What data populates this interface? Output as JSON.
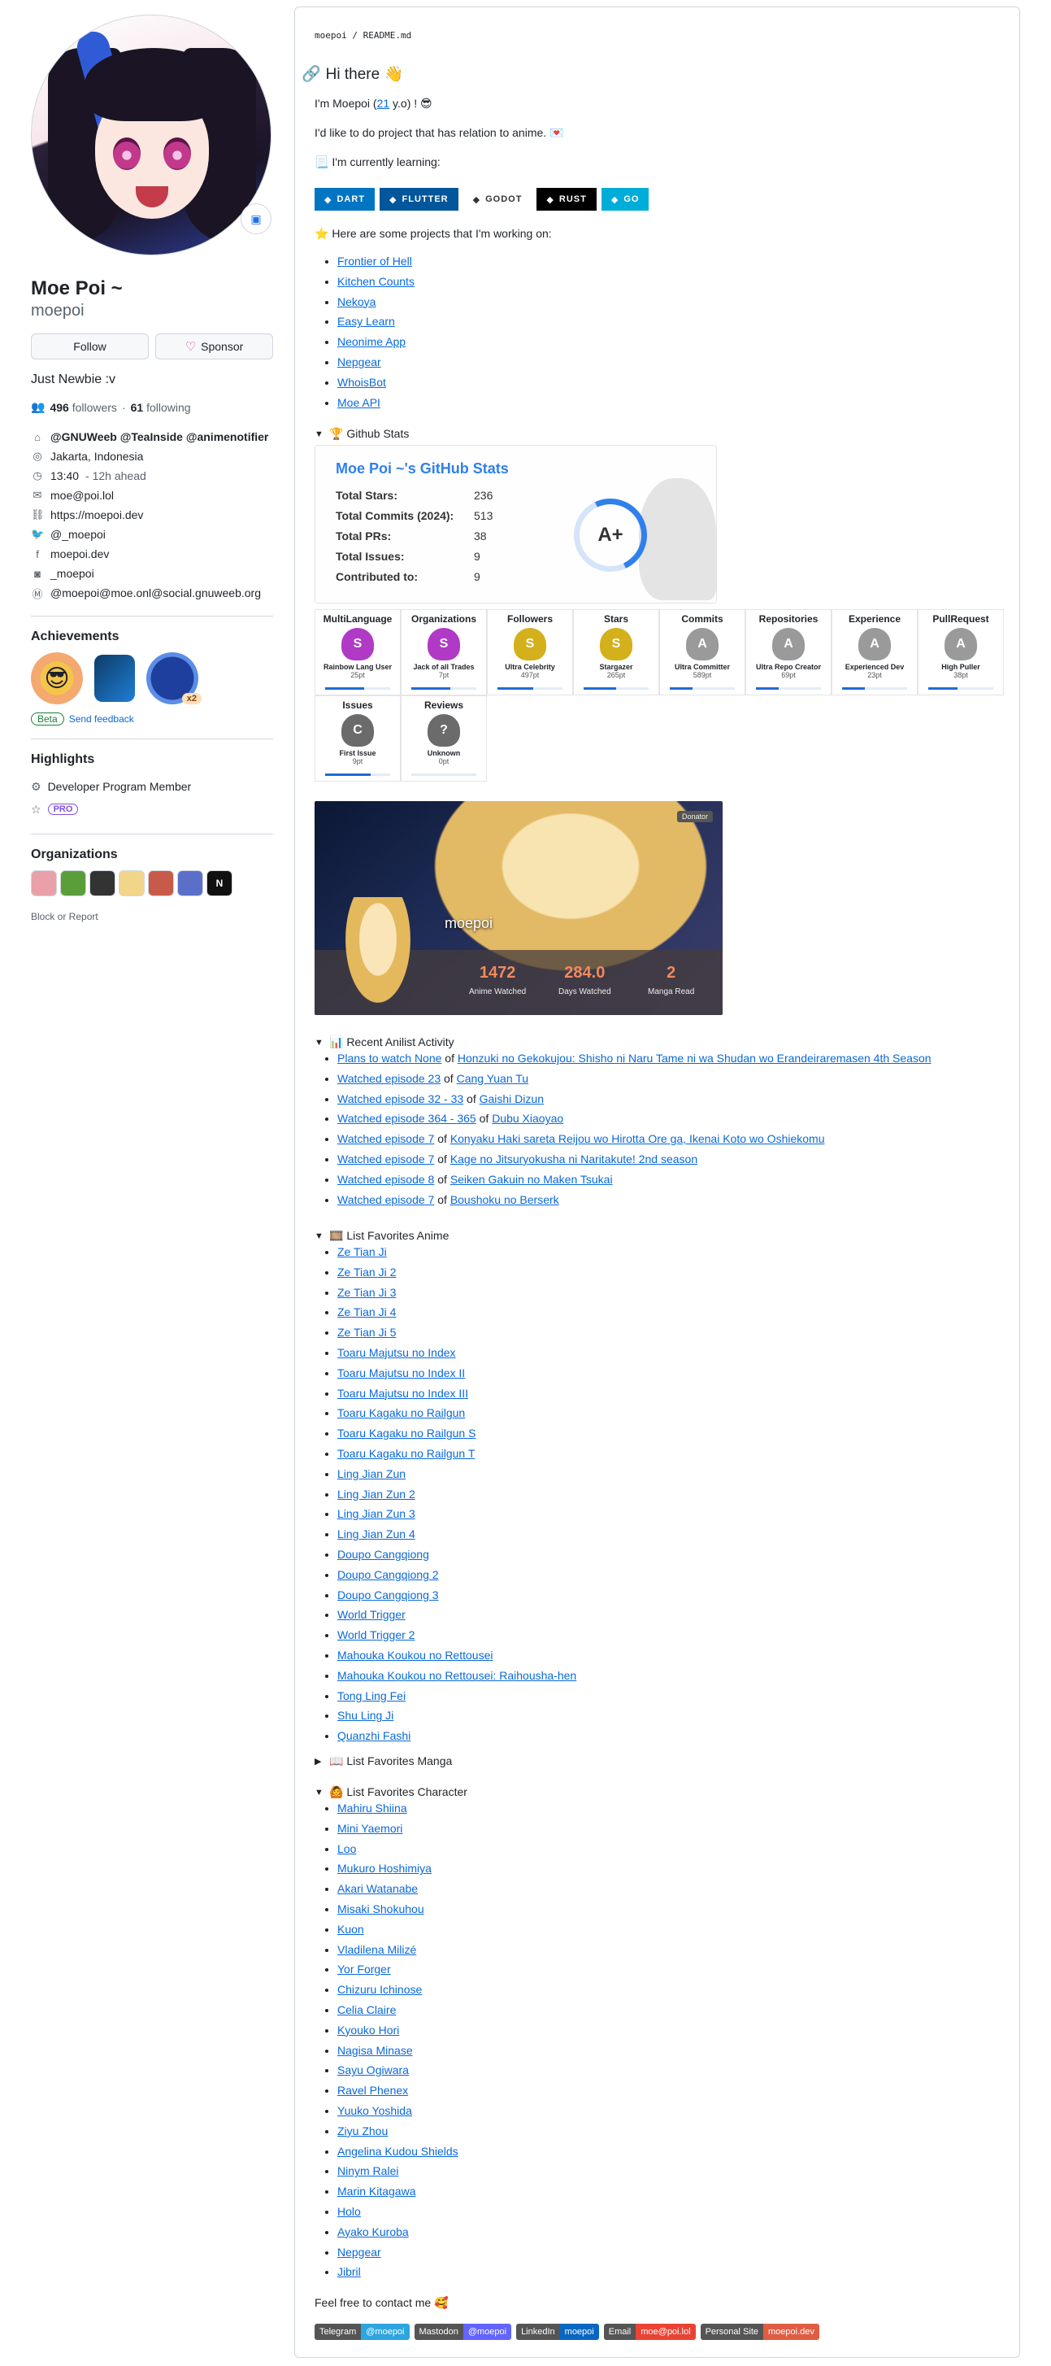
{
  "profile": {
    "fullname": "Moe Poi ~",
    "login": "moepoi",
    "follow_label": "Follow",
    "sponsor_label": "Sponsor",
    "bio": "Just Newbie :v",
    "followers": "496",
    "followers_label": "followers",
    "dot": "·",
    "following": "61",
    "following_label": "following",
    "details": [
      {
        "icon": "organization-icon",
        "glyph": "⌂",
        "text": "@GNUWeeb @TeaInside @animenotifier",
        "bold": true
      },
      {
        "icon": "location-icon",
        "glyph": "◎",
        "text": "Jakarta, Indonesia"
      },
      {
        "icon": "clock-icon",
        "glyph": "◷",
        "text": "13:40",
        "suffix": " - 12h ahead"
      },
      {
        "icon": "mail-icon",
        "glyph": "✉",
        "text": "moe@poi.lol"
      },
      {
        "icon": "link-icon",
        "glyph": "⛓",
        "text": "https://moepoi.dev"
      },
      {
        "icon": "twitter-icon",
        "glyph": "🐦",
        "text": "@_moepoi"
      },
      {
        "icon": "facebook-icon",
        "glyph": "f",
        "text": "moepoi.dev"
      },
      {
        "icon": "instagram-icon",
        "glyph": "◙",
        "text": "_moepoi"
      },
      {
        "icon": "mastodon-icon",
        "glyph": "Ⓜ",
        "text": "@moepoi@moe.onl@social.gnuweeb.org"
      }
    ],
    "achievements_title": "Achievements",
    "achievement_badge": "x2",
    "beta_label": "Beta",
    "feedback_label": "Send feedback",
    "highlights_title": "Highlights",
    "highlight_member": "Developer Program Member",
    "highlight_pro": "PRO",
    "organizations_title": "Organizations",
    "block_label": "Block or Report"
  },
  "readme": {
    "path_user": "moepoi",
    "path_sep": " / ",
    "path_file": "README.md",
    "greeting": "Hi there 👋",
    "intro_pre": "I'm Moepoi (",
    "intro_age": "21",
    "intro_post": " y.o) ! 😎",
    "intro_anime": "I'd like to do project that has relation to anime. 💌",
    "learning": "📃 I'm currently learning:",
    "langs": [
      {
        "label": "DART",
        "color": "#0175c2"
      },
      {
        "label": "FLUTTER",
        "color": "#02569b"
      },
      {
        "label": "GODOT",
        "color": "#ffffff"
      },
      {
        "label": "RUST",
        "color": "#000000"
      },
      {
        "label": "GO",
        "color": "#00add8"
      }
    ],
    "projects_intro": "⭐ Here are some projects that I'm working on:",
    "projects": [
      "Frontier of Hell",
      "Kitchen Counts",
      "Nekoya",
      "Easy Learn",
      "Neonime App",
      "Nepgear",
      "WhoisBot",
      "Moe API"
    ],
    "github_stats_summary": "🏆 Github Stats",
    "stats": {
      "title": "Moe Poi ~'s GitHub Stats",
      "rows": [
        {
          "k": "Total Stars:",
          "v": "236"
        },
        {
          "k": "Total Commits (2024):",
          "v": "513"
        },
        {
          "k": "Total PRs:",
          "v": "38"
        },
        {
          "k": "Total Issues:",
          "v": "9"
        },
        {
          "k": "Contributed to:",
          "v": "9"
        }
      ],
      "grade": "A+",
      "grade_fraction": 0.35
    },
    "trophies": [
      {
        "t": "MultiLanguage",
        "rank": "S",
        "n": "Rainbow Lang User",
        "pt": "25pt",
        "color": "#b03ac6",
        "progress": 0.6
      },
      {
        "t": "Organizations",
        "rank": "S",
        "n": "Jack of all Trades",
        "pt": "7pt",
        "color": "#b03ac6",
        "progress": 0.6
      },
      {
        "t": "Followers",
        "rank": "S",
        "n": "Ultra Celebrity",
        "pt": "497pt",
        "color": "#d4b01c",
        "progress": 0.55
      },
      {
        "t": "Stars",
        "rank": "S",
        "n": "Stargazer",
        "pt": "265pt",
        "color": "#d4b01c",
        "progress": 0.5
      },
      {
        "t": "Commits",
        "rank": "A",
        "n": "Ultra Committer",
        "pt": "589pt",
        "color": "#9a9a9a",
        "progress": 0.35
      },
      {
        "t": "Repositories",
        "rank": "A",
        "n": "Ultra Repo Creator",
        "pt": "69pt",
        "color": "#9a9a9a",
        "progress": 0.35
      },
      {
        "t": "Experience",
        "rank": "A",
        "n": "Experienced Dev",
        "pt": "23pt",
        "color": "#9a9a9a",
        "progress": 0.35
      },
      {
        "t": "PullRequest",
        "rank": "A",
        "n": "High Puller",
        "pt": "38pt",
        "color": "#9a9a9a",
        "progress": 0.45
      },
      {
        "t": "Issues",
        "rank": "C",
        "n": "First Issue",
        "pt": "9pt",
        "color": "#6b6b6b",
        "progress": 0.7
      },
      {
        "t": "Reviews",
        "rank": "?",
        "n": "Unknown",
        "pt": "0pt",
        "color": "#6b6b6b",
        "progress": 0.0
      }
    ],
    "anilist": {
      "name": "moepoi",
      "donator": "Donator",
      "stats": [
        {
          "num": "1472",
          "lbl": "Anime Watched"
        },
        {
          "num": "284.0",
          "lbl": "Days Watched"
        },
        {
          "num": "2",
          "lbl": "Manga Read"
        }
      ]
    },
    "activity_summary": "📊 Recent Anilist Activity",
    "activity": [
      {
        "a": "Plans to watch None",
        "b": "Honzuki no Gekokujou: Shisho ni Naru Tame ni wa Shudan wo Erandeiraremasen 4th Season"
      },
      {
        "a": "Watched episode 23",
        "b": "Cang Yuan Tu"
      },
      {
        "a": "Watched episode 32 - 33",
        "b": "Gaishi Dizun"
      },
      {
        "a": "Watched episode 364 - 365",
        "b": "Dubu Xiaoyao"
      },
      {
        "a": "Watched episode 7",
        "b": "Konyaku Haki sareta Reijou wo Hirotta Ore ga, Ikenai Koto wo Oshiekomu"
      },
      {
        "a": "Watched episode 7",
        "b": "Kage no Jitsuryokusha ni Naritakute! 2nd season"
      },
      {
        "a": "Watched episode 8",
        "b": "Seiken Gakuin no Maken Tsukai"
      },
      {
        "a": "Watched episode 7",
        "b": "Boushoku no Berserk"
      }
    ],
    "of_label": " of ",
    "fav_anime_summary": "🎞️ List Favorites Anime",
    "fav_anime": [
      "Ze Tian Ji",
      "Ze Tian Ji 2",
      "Ze Tian Ji 3",
      "Ze Tian Ji 4",
      "Ze Tian Ji 5",
      "Toaru Majutsu no Index",
      "Toaru Majutsu no Index II",
      "Toaru Majutsu no Index III",
      "Toaru Kagaku no Railgun",
      "Toaru Kagaku no Railgun S",
      "Toaru Kagaku no Railgun T",
      "Ling Jian Zun",
      "Ling Jian Zun 2",
      "Ling Jian Zun 3",
      "Ling Jian Zun 4",
      "Doupo Cangqiong",
      "Doupo Cangqiong 2",
      "Doupo Cangqiong 3",
      "World Trigger",
      "World Trigger 2",
      "Mahouka Koukou no Rettousei",
      "Mahouka Koukou no Rettousei: Raihousha-hen",
      "Tong Ling Fei",
      "Shu Ling Ji",
      "Quanzhi Fashi"
    ],
    "fav_manga_summary": "📖 List Favorites Manga",
    "fav_char_summary": "🙆 List Favorites Character",
    "fav_char": [
      "Mahiru Shiina",
      "Mini Yaemori",
      "Loo",
      "Mukuro Hoshimiya",
      "Akari Watanabe",
      "Misaki Shokuhou",
      "Kuon",
      "Vladilena Milizé",
      "Yor Forger",
      "Chizuru Ichinose",
      "Celia Claire",
      "Kyouko Hori",
      "Nagisa Minase",
      "Sayu Ogiwara",
      "Ravel Phenex",
      "Yuuko Yoshida",
      "Ziyu Zhou",
      "Angelina Kudou Shields",
      "Ninym Ralei",
      "Marin Kitagawa",
      "Holo",
      "Ayako Kuroba",
      "Nepgear",
      "Jibril"
    ],
    "contact_intro": "Feel free to contact me 🥰",
    "contacts": [
      {
        "l": "Telegram",
        "r": "@moepoi",
        "color": "#2ca5e0"
      },
      {
        "l": "Mastodon",
        "r": "@moepoi",
        "color": "#6364ff"
      },
      {
        "l": "LinkedIn",
        "r": "moepoi",
        "color": "#0a66c2"
      },
      {
        "l": "Email",
        "r": "moe@poi.lol",
        "color": "#ea4335"
      },
      {
        "l": "Personal Site",
        "r": "moepoi.dev",
        "color": "#e05d44"
      }
    ]
  }
}
